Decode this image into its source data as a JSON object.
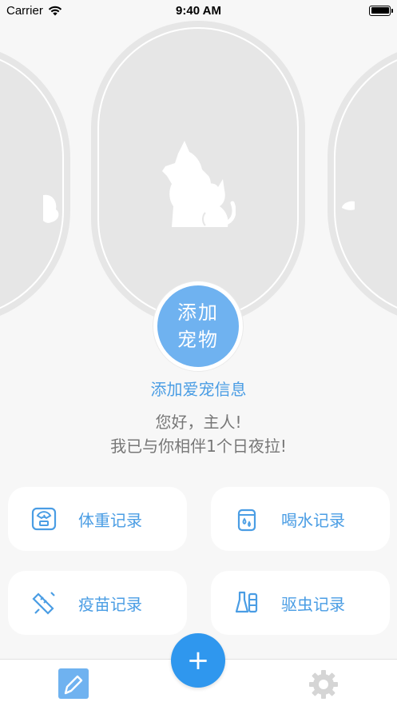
{
  "status_bar": {
    "carrier": "Carrier",
    "time": "9:40 AM"
  },
  "add_pet": {
    "button_label": "添加宠物",
    "link_text": "添加爱宠信息"
  },
  "greeting": {
    "line1": "您好，主人!",
    "line2": "我已与你相伴1个日夜拉!"
  },
  "records": [
    {
      "label": "体重记录",
      "icon": "scale-icon"
    },
    {
      "label": "喝水记录",
      "icon": "water-cup-icon"
    },
    {
      "label": "疫苗记录",
      "icon": "syringe-icon"
    },
    {
      "label": "驱虫记录",
      "icon": "deworm-bottle-icon"
    }
  ],
  "tab_bar": {
    "fab_symbol": "+",
    "tabs": [
      "edit-icon",
      "gear-icon"
    ]
  },
  "colors": {
    "accent": "#4a9de4",
    "add_pet_circle": "#6fb2f0",
    "fab": "#2f97ee",
    "card_bg": "#e6e6e6"
  }
}
